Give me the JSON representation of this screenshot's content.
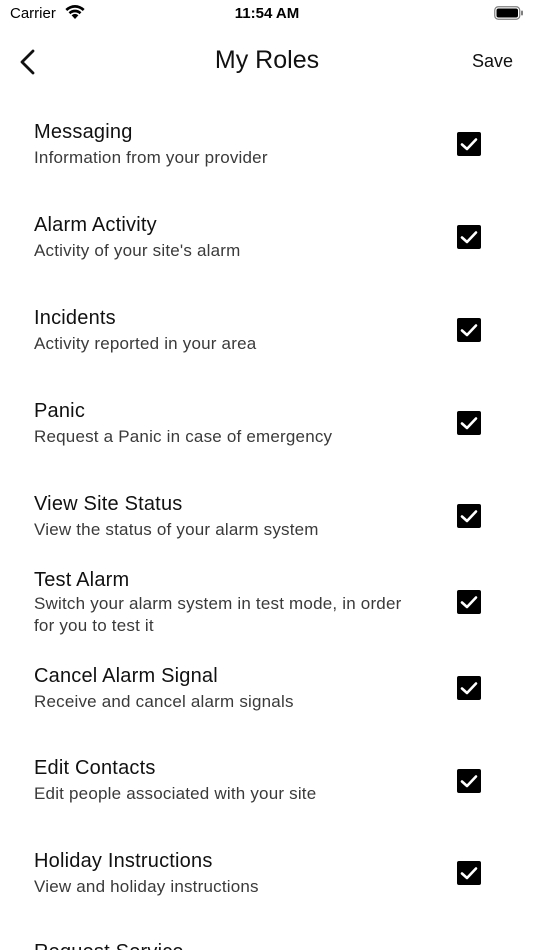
{
  "status_bar": {
    "carrier": "Carrier",
    "time": "11:54 AM"
  },
  "nav": {
    "title": "My Roles",
    "save_label": "Save"
  },
  "colors": {
    "text": "#111111",
    "subtext": "#3a3a3a",
    "checkbox_fill": "#000000",
    "background": "#ffffff"
  },
  "roles": [
    {
      "title": "Messaging",
      "description": "Information from your provider",
      "checked": true
    },
    {
      "title": "Alarm Activity",
      "description": "Activity of your site's alarm",
      "checked": true
    },
    {
      "title": "Incidents",
      "description": "Activity reported in your area",
      "checked": true
    },
    {
      "title": "Panic",
      "description": "Request a Panic in case of emergency",
      "checked": true
    },
    {
      "title": "View Site Status",
      "description": "View the status of your alarm system",
      "checked": true
    },
    {
      "title": "Test Alarm",
      "description": "Switch your alarm system in test mode,  in order for you to test it",
      "checked": true
    },
    {
      "title": "Cancel Alarm Signal",
      "description": "Receive and cancel alarm signals",
      "checked": true
    },
    {
      "title": "Edit Contacts",
      "description": "Edit people associated with your site",
      "checked": true
    },
    {
      "title": "Holiday Instructions",
      "description": "View and holiday instructions",
      "checked": true
    },
    {
      "title": "Request Service",
      "description": "",
      "checked": true
    }
  ]
}
